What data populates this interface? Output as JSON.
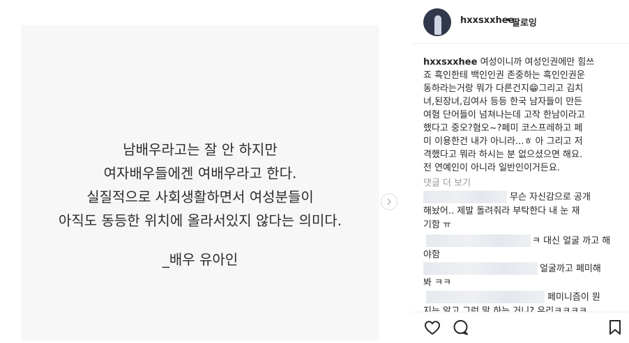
{
  "post": {
    "quote_lines": [
      "남배우라고는 잘 안 하지만",
      "여자배우들에겐 여배우라고 한다.",
      "실질적으로 사회생활하면서 여성분들이",
      "아직도 동등한 위치에 올라서있지 않다는 의미다."
    ],
    "quote_author": "_배우 유아인"
  },
  "header": {
    "username": "hxxsxxhee",
    "separator": "•",
    "follow_label": "팔로잉"
  },
  "caption": {
    "username": "hxxsxxhee",
    "lines": [
      " 여성이니까 여성인권에만 힘쓰",
      "죠 흑인한테 백인인권 존중하는 흑인인권운",
      "동하라는거랑 뭐가 다른건지😁그리고 김치",
      "녀,된장녀,김여사 등등 한국 남자들이 만든",
      "여혐 단어들이 넘쳐나는데 고작 한남이라고",
      "했다고 중오?혐오~?페미 코스프레하고 페",
      "미 이용한건 내가 아니라...ㅎ 아 그리고 저",
      "격했다고 뭐라 하시는 분 없으셨으면 해요.",
      "전 연예인이 아니라 일반인이거든요."
    ]
  },
  "comments": {
    "view_more_label": "댓글 더 보기",
    "items": [
      {
        "lines": [
          "무슨 자신감으로 공개",
          "해놨어.. 제발 돌려줘라 부탁한다 내 눈 재",
          "기함 ㅠ"
        ]
      },
      {
        "lines": [
          "ㅋ 대신 얼굴 까고 해",
          "야함"
        ]
      },
      {
        "lines": [
          "얼굴까고 페미해",
          "봐 ㅋㅋ"
        ]
      },
      {
        "lines": [
          "페미니즘이 뭔",
          "지는 알고 그런 말 하는 거니? 우리ㅋㅋㅋㅋ"
        ]
      }
    ]
  },
  "icons": {
    "like": "heart-icon",
    "comment": "comment-icon",
    "save": "bookmark-icon",
    "next": "chevron-right-icon"
  }
}
